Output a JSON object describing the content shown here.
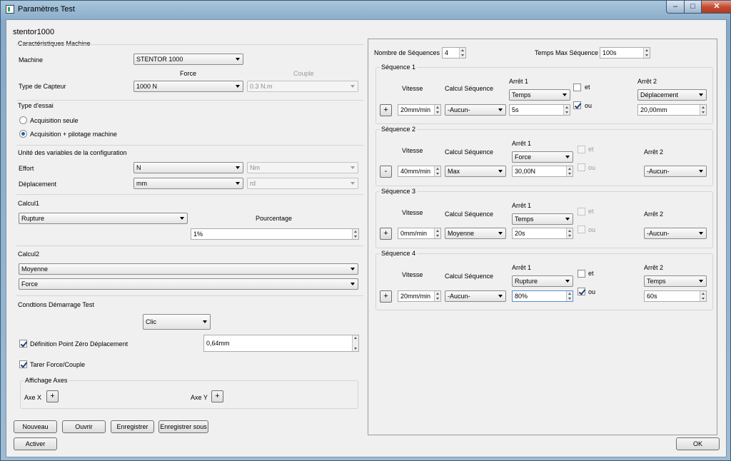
{
  "window": {
    "title": "Paramètres Test"
  },
  "machine_name": "stentor1000",
  "caracteristiques": {
    "title": "Caractéristiques Machine",
    "machine_label": "Machine",
    "machine_value": "STENTOR 1000",
    "force_header": "Force",
    "couple_header": "Couple",
    "capteur_label": "Type de Capteur",
    "force_value": "1000 N",
    "couple_value": "0.3 N.m"
  },
  "type_essai": {
    "title": "Type d'essai",
    "option1": "Acquisition seule",
    "option2": "Acquisition + pilotage machine",
    "selected": 2
  },
  "unites": {
    "title": "Unité des variables de la configuration",
    "effort_label": "Effort",
    "effort_value": "N",
    "effort_couple": "Nm",
    "deplacement_label": "Déplacement",
    "deplacement_value": "mm",
    "deplacement_couple": "rd"
  },
  "calcul1": {
    "title": "Calcul1",
    "value": "Rupture",
    "pourcentage_label": "Pourcentage",
    "pourcentage_value": "1%"
  },
  "calcul2": {
    "title": "Calcul2",
    "value1": "Moyenne",
    "value2": "Force"
  },
  "demarrage": {
    "title": "Condtions Démarrage Test",
    "mode_value": "Clic",
    "def_point_zero_label": "Définition Point Zéro Déplacement",
    "def_point_zero_value": "0,64mm",
    "tarer_label": "Tarer Force/Couple",
    "affichage_title": "Affichage Axes",
    "axe_x_label": "Axe X",
    "axe_y_label": "Axe Y",
    "plus": "+"
  },
  "buttons": {
    "nouveau": "Nouveau",
    "ouvrir": "Ouvrir",
    "enregistrer": "Enregistrer",
    "enregistrer_sous": "Enregistrer sous",
    "activer": "Activer",
    "ok": "OK"
  },
  "sequences": {
    "nombre_label": "Nombre de Séquences",
    "nombre_value": "4",
    "temps_max_label": "Temps Max Séquence",
    "temps_max_value": "100s",
    "headers": {
      "vitesse": "Vitesse",
      "calcul": "Calcul Séquence",
      "arret1": "Arrêt 1",
      "arret2": "Arrêt 2",
      "et": "et",
      "ou": "ou"
    },
    "items": [
      {
        "title": "Séquence 1",
        "button": "+",
        "vitesse": "20mm/min",
        "calcul": "-Aucun-",
        "arret1_type": "Temps",
        "arret1_value": "5s",
        "arret2_type": "Déplacement",
        "arret2_value": "20,00mm"
      },
      {
        "title": "Séquence 2",
        "button": "-",
        "vitesse": "40mm/min",
        "calcul": "Max",
        "arret1_type": "Force",
        "arret1_value": "30,00N",
        "arret2_type": "-Aucun-"
      },
      {
        "title": "Séquence 3",
        "button": "+",
        "vitesse": "0mm/min",
        "calcul": "Moyenne",
        "arret1_type": "Temps",
        "arret1_value": "20s",
        "arret2_type": "-Aucun-"
      },
      {
        "title": "Séquence 4",
        "button": "+",
        "vitesse": "20mm/min",
        "calcul": "-Aucun-",
        "arret1_type": "Rupture",
        "arret1_value": "80%",
        "arret2_type": "Temps",
        "arret2_value": "60s"
      }
    ]
  }
}
